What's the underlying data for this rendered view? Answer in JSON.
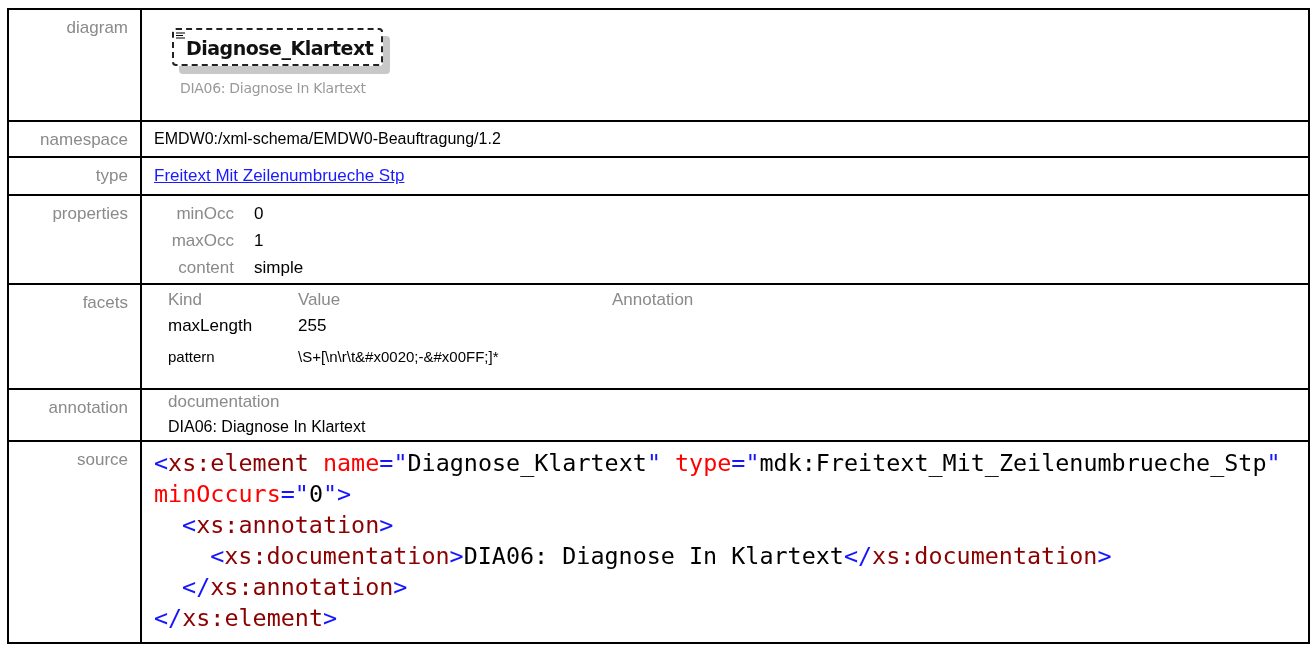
{
  "diagram": {
    "label": "diagram",
    "element_name": "Diagnose_Klartext",
    "caption": "DIA06: Diagnose In Klartext"
  },
  "namespace": {
    "label": "namespace",
    "value": "EMDW0:/xml-schema/EMDW0-Beauftragung/1.2"
  },
  "type": {
    "label": "type",
    "link": "Freitext Mit Zeilenumbrueche Stp"
  },
  "properties": {
    "label": "properties",
    "items": [
      {
        "name": "minOcc",
        "value": "0"
      },
      {
        "name": "maxOcc",
        "value": "1"
      },
      {
        "name": "content",
        "value": "simple"
      }
    ]
  },
  "facets": {
    "label": "facets",
    "columns": [
      "Kind",
      "Value",
      "Annotation"
    ],
    "rows": [
      {
        "kind": "maxLength",
        "value": "255"
      },
      {
        "kind": "pattern",
        "value": "\\S+[\\n\\r\\t&#x0020;-&#x00FF;]*"
      }
    ]
  },
  "annotation": {
    "label": "annotation",
    "heading": "documentation",
    "text": "DIA06: Diagnose In Klartext"
  },
  "source": {
    "label": "source",
    "lines": [
      {
        "tokens": [
          {
            "kind": "bracket",
            "text": "<"
          },
          {
            "kind": "tag",
            "text": "xs:element"
          },
          {
            "kind": "attr",
            "text": "name",
            "space_before": true
          },
          {
            "kind": "bracket",
            "text": "=\""
          },
          {
            "kind": "plain",
            "text": "Diagnose_Klartext"
          },
          {
            "kind": "bracket",
            "text": "\""
          },
          {
            "kind": "attr",
            "text": "type",
            "space_before": true
          },
          {
            "kind": "bracket",
            "text": "=\""
          },
          {
            "kind": "plain",
            "text": "mdk:Freitext_Mit_Zeilenumbrueche_Stp"
          },
          {
            "kind": "bracket",
            "text": "\""
          }
        ]
      },
      {
        "tokens": [
          {
            "kind": "attr",
            "text": "minOccurs"
          },
          {
            "kind": "bracket",
            "text": "=\""
          },
          {
            "kind": "plain",
            "text": "0"
          },
          {
            "kind": "bracket",
            "text": "\">"
          }
        ],
        "children": [
          {
            "tokens": [
              {
                "kind": "bracket",
                "text": "<"
              },
              {
                "kind": "tag",
                "text": "xs:annotation"
              },
              {
                "kind": "bracket",
                "text": ">"
              }
            ],
            "children": [
              {
                "tokens": [
                  {
                    "kind": "bracket",
                    "text": "<"
                  },
                  {
                    "kind": "tag",
                    "text": "xs:documentation"
                  },
                  {
                    "kind": "bracket",
                    "text": ">"
                  },
                  {
                    "kind": "plain",
                    "text": "DIA06: Diagnose In Klartext"
                  },
                  {
                    "kind": "bracket",
                    "text": "</"
                  },
                  {
                    "kind": "tag",
                    "text": "xs:documentation"
                  },
                  {
                    "kind": "bracket",
                    "text": ">"
                  }
                ]
              }
            ]
          },
          {
            "tokens": [
              {
                "kind": "bracket",
                "text": "</"
              },
              {
                "kind": "tag",
                "text": "xs:annotation"
              },
              {
                "kind": "bracket",
                "text": ">"
              }
            ]
          }
        ]
      },
      {
        "tokens": [
          {
            "kind": "bracket",
            "text": "</"
          },
          {
            "kind": "tag",
            "text": "xs:element"
          },
          {
            "kind": "bracket",
            "text": ">"
          }
        ]
      }
    ]
  }
}
